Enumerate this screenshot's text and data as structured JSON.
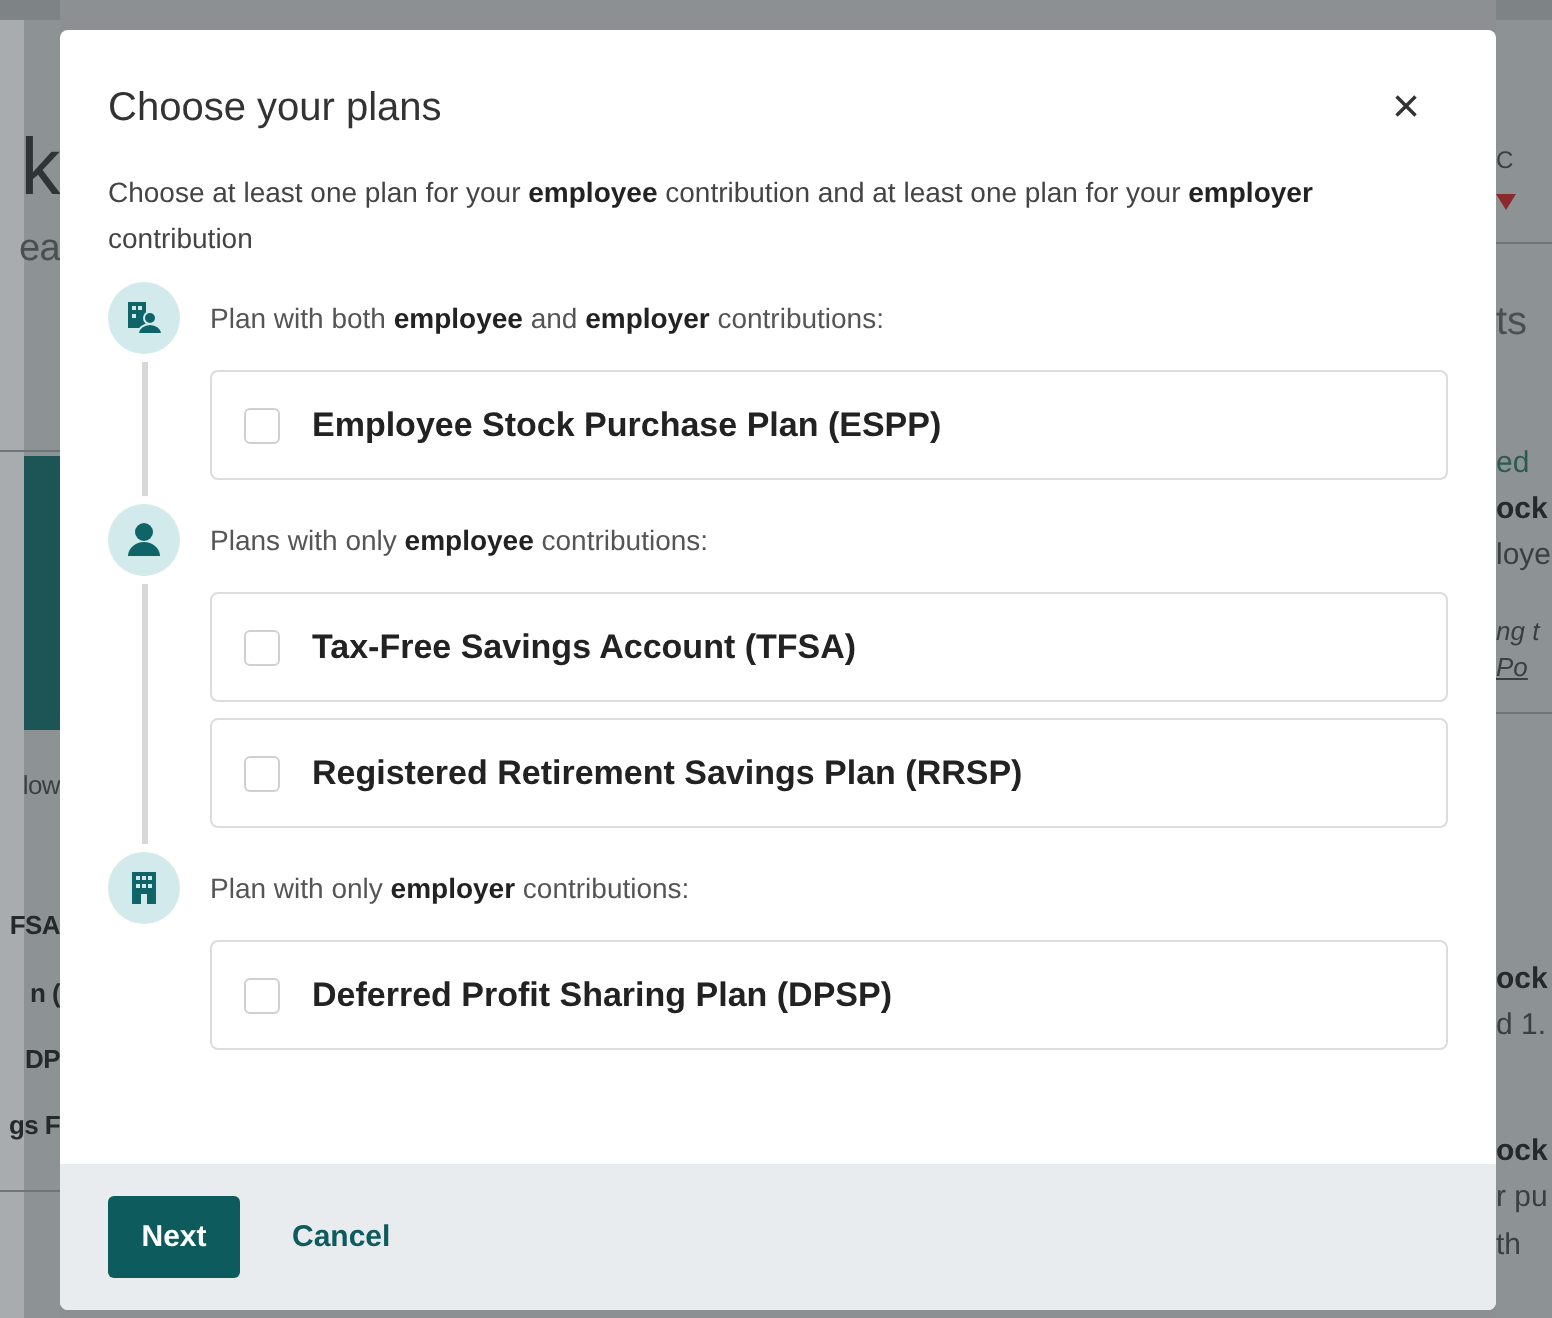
{
  "background": {
    "left": [
      {
        "kind": "heading",
        "text": "k"
      },
      {
        "kind": "subtitle",
        "text": "ea"
      },
      {
        "kind": "divider"
      },
      {
        "kind": "block"
      },
      {
        "kind": "text",
        "text": "low"
      },
      {
        "kind": "bold",
        "text": "FSA"
      },
      {
        "kind": "bold",
        "text": "n ("
      },
      {
        "kind": "bold",
        "text": "DP"
      },
      {
        "kind": "bold",
        "text": "gs F"
      },
      {
        "kind": "divider"
      }
    ],
    "right": [
      {
        "kind": "small",
        "text": "C"
      },
      {
        "kind": "marker"
      },
      {
        "kind": "divider"
      },
      {
        "kind": "subtitle",
        "text": "ts"
      },
      {
        "kind": "green",
        "text": "ed"
      },
      {
        "kind": "bold",
        "text": "ock"
      },
      {
        "kind": "text",
        "text": "loye"
      },
      {
        "kind": "italic",
        "text": "ng t"
      },
      {
        "kind": "link",
        "text": "Po"
      },
      {
        "kind": "divider"
      },
      {
        "kind": "bold",
        "text": "ock"
      },
      {
        "kind": "text",
        "text": "d 1."
      },
      {
        "kind": "bold",
        "text": "ock"
      },
      {
        "kind": "text",
        "text": "r pu"
      },
      {
        "kind": "text",
        "text": "th"
      }
    ]
  },
  "dialog": {
    "title": "Choose your plans",
    "close": "×",
    "intro": "Choose at least one plan for your **employee** contribution and at least one plan for your **employer** contribution",
    "groups": [
      {
        "kind": "both",
        "heading": "Plan with both **employee** and **employer** contributions:",
        "plans": [
          {
            "label": "Employee Stock Purchase Plan (ESPP)",
            "checked": false
          }
        ]
      },
      {
        "kind": "employee",
        "heading": "Plans with only **employee** contributions:",
        "plans": [
          {
            "label": "Tax-Free Savings Account (TFSA)",
            "checked": false
          },
          {
            "label": "Registered Retirement Savings Plan (RRSP)",
            "checked": false
          }
        ]
      },
      {
        "kind": "employer",
        "heading": "Plan with only **employer** contributions:",
        "plans": [
          {
            "label": "Deferred Profit Sharing Plan (DPSP)",
            "checked": false
          }
        ]
      }
    ],
    "buttons": {
      "next": "Next",
      "cancel": "Cancel"
    }
  }
}
